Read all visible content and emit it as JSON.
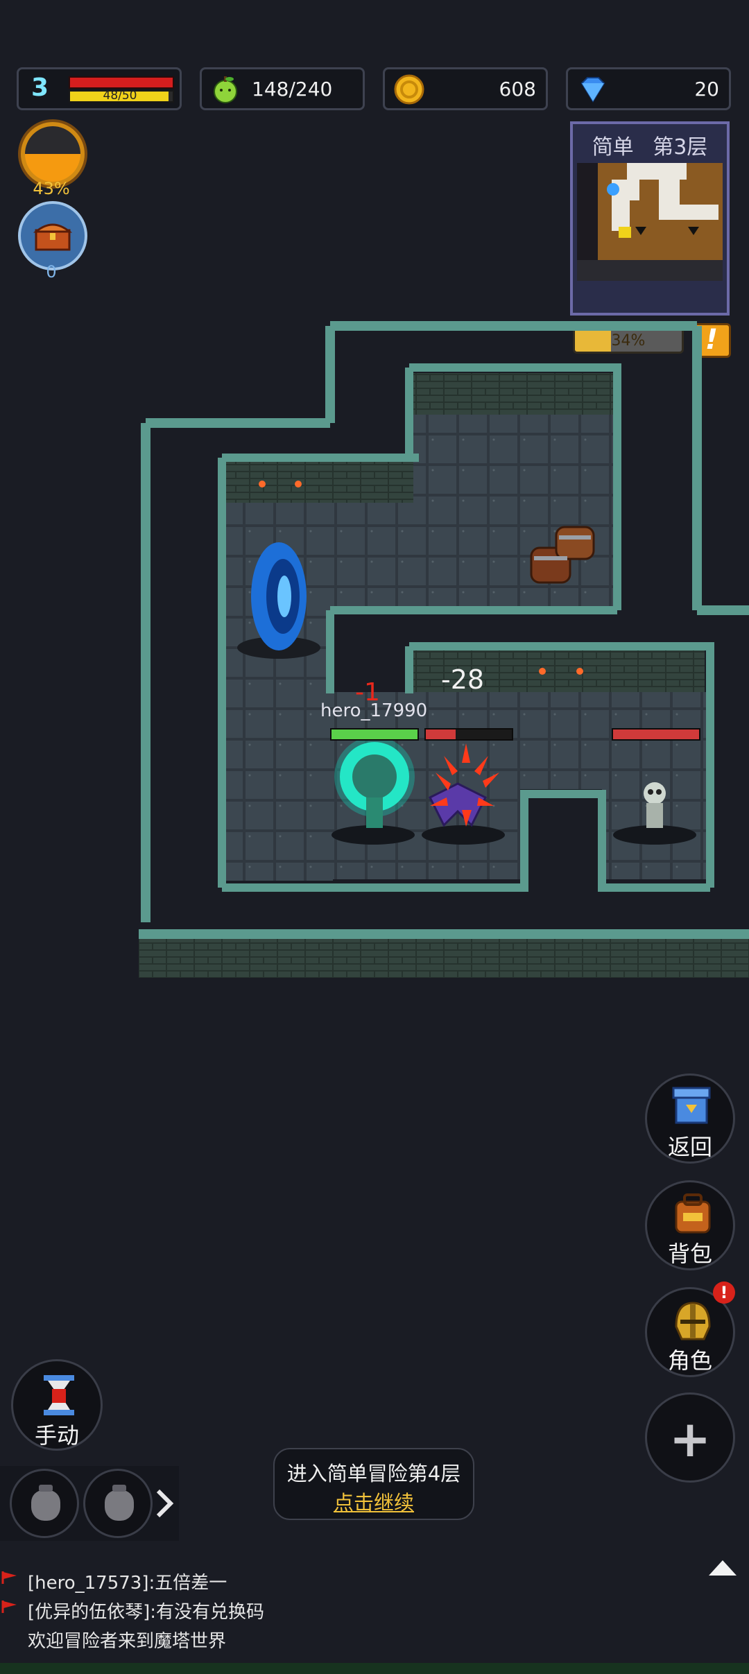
{
  "hud": {
    "level": "3",
    "mp_text": "48/50",
    "mp_fraction": 0.96,
    "hp_fraction": 1.0,
    "energy": "148/240",
    "gold": "608",
    "gems": "20"
  },
  "orbs": {
    "power_percent": "43%",
    "treasure_count": "0"
  },
  "minimap": {
    "title": "简单 第3层"
  },
  "floor_progress": {
    "text": "34%",
    "fraction": 0.34
  },
  "alert_icon": "!",
  "battle": {
    "player_name": "hero_17990",
    "damage_to_player": "-1",
    "damage_to_enemy": "-28",
    "player_hp_fraction": 1.0,
    "bat_hp_fraction": 0.35,
    "skeleton_hp_fraction": 1.0
  },
  "menu": {
    "back": "返回",
    "bag": "背包",
    "character": "角色",
    "add": "+"
  },
  "auto_button": "手动",
  "prompt": {
    "line1": "进入简单冒险第4层",
    "line2": "点击继续"
  },
  "chat": [
    "[hero_17573]:五倍差一",
    "[优异的伍依琴]:有没有兑换码",
    "欢迎冒险者来到魔塔世界"
  ],
  "icons": [
    "potion-slot-icon",
    "arrow-right-icon",
    "collapse-up-icon",
    "hourglass-icon",
    "tower-icon",
    "backpack-icon",
    "helmet-icon",
    "plus-icon",
    "gold-coin-icon",
    "diamond-icon",
    "apple-energy-icon"
  ],
  "colors": {
    "hp": "#d51e1e",
    "mp": "#f0d21a",
    "gold": "#f2c23a",
    "wall": "#5b9a8e",
    "floor": "#3c4a52"
  }
}
